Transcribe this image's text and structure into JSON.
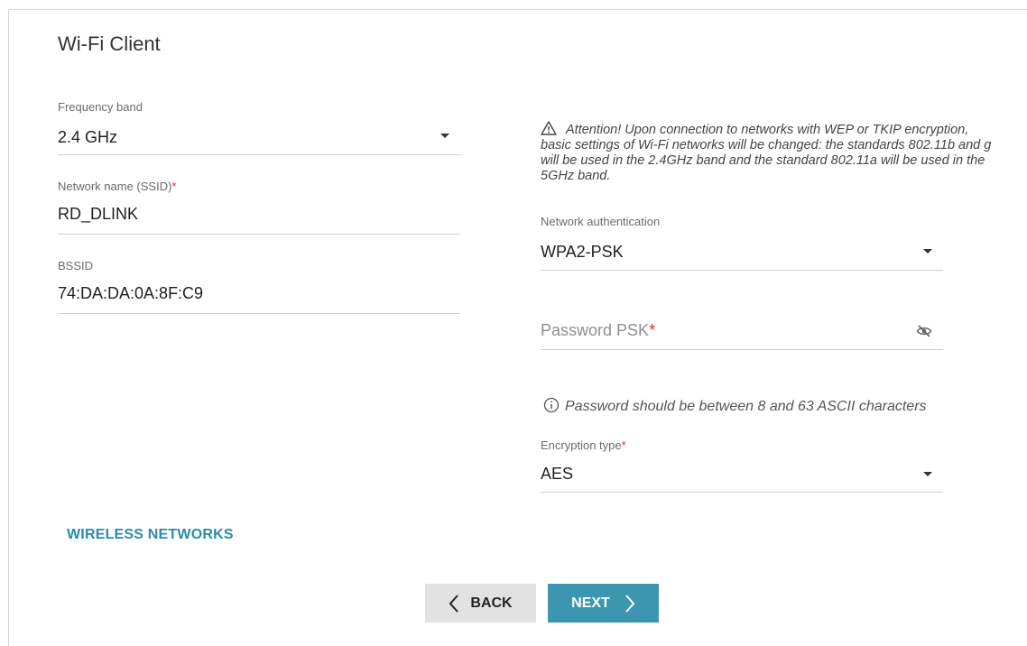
{
  "page": {
    "title": "Wi-Fi Client"
  },
  "left": {
    "frequency_band": {
      "label": "Frequency band",
      "value": "2.4 GHz"
    },
    "ssid": {
      "label": "Network name (SSID)",
      "required_mark": "*",
      "value": "RD_DLINK"
    },
    "bssid": {
      "label": "BSSID",
      "value": "74:DA:DA:0A:8F:C9"
    }
  },
  "right": {
    "attention": "Attention! Upon connection to networks with WEP or TKIP encryption, basic settings of Wi-Fi networks will be changed: the standards 802.11b and g will be used in the 2.4GHz band and the standard 802.11a will be used in the 5GHz band.",
    "auth": {
      "label": "Network authentication",
      "value": "WPA2-PSK"
    },
    "password": {
      "placeholder": "Password PSK",
      "required_mark": "*",
      "value": ""
    },
    "password_hint": "Password should be between 8 and 63 ASCII characters",
    "encryption": {
      "label": "Encryption type",
      "required_mark": "*",
      "value": "AES"
    }
  },
  "links": {
    "wireless_networks": "WIRELESS NETWORKS"
  },
  "buttons": {
    "back": "BACK",
    "next": "NEXT"
  },
  "colors": {
    "accent": "#3d96b0",
    "link": "#2a8bb0",
    "required": "#e0293c"
  },
  "icons": [
    "warning-icon",
    "eye-off-icon",
    "info-icon",
    "chevron-left-icon",
    "chevron-right-icon",
    "dropdown-caret-icon"
  ]
}
